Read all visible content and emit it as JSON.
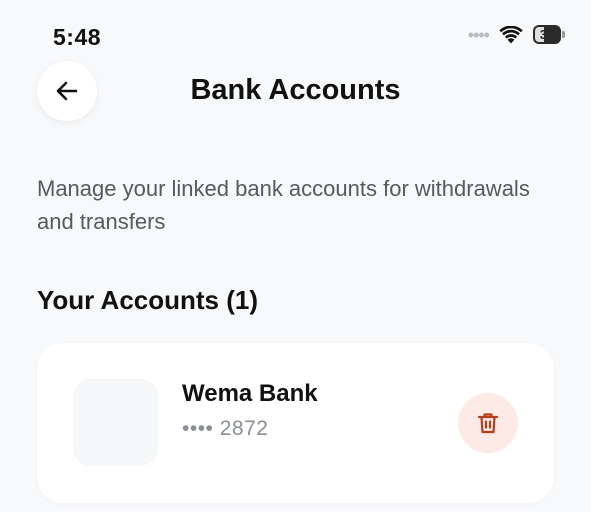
{
  "status_bar": {
    "time": "5:48",
    "signal": "••••",
    "battery": "33",
    "wifi_icon": "wifi-icon"
  },
  "header": {
    "back_icon": "arrow-left-icon",
    "title": "Bank Accounts"
  },
  "description": "Manage your linked bank accounts for withdrawals and transfers",
  "accounts_section": {
    "title": "Your Accounts (1)",
    "accounts": [
      {
        "bank_name": "Wema Bank",
        "account_number": "•••• 2872",
        "delete_icon": "trash-icon"
      }
    ]
  },
  "colors": {
    "background": "#f8f9fa",
    "card": "#ffffff",
    "delete_accent": "#b5401f",
    "delete_bg": "#fbeae6"
  }
}
